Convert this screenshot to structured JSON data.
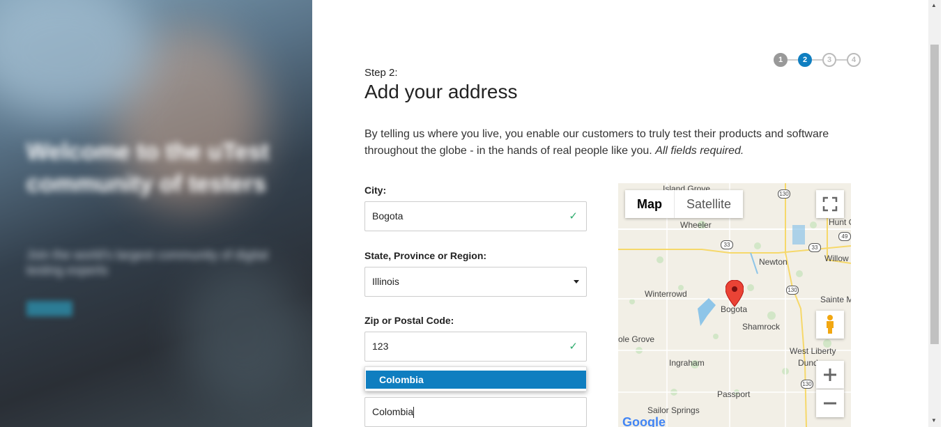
{
  "hero": {
    "title": "Welcome to the uTest community of testers",
    "subtitle": "Join the world's largest community of digital testing experts",
    "button": "Learn"
  },
  "stepper": {
    "steps": [
      "1",
      "2",
      "3",
      "4"
    ],
    "current": 2
  },
  "form": {
    "step_label": "Step 2:",
    "title": "Add your address",
    "intro": "By telling us where you live, you enable our customers to truly test their products and software throughout the globe - in the hands of real people like you.",
    "intro_required": "All fields required.",
    "city_label": "City:",
    "city_value": "Bogota",
    "state_label": "State, Province or Region:",
    "state_value": "Illinois",
    "zip_label": "Zip or Postal Code:",
    "zip_value": "123",
    "country_suggestion": "Colombia",
    "country_value": "Colombia"
  },
  "map": {
    "type_map": "Map",
    "type_satellite": "Satellite",
    "labels": {
      "island_grove": "Island Grove",
      "hunt_city": "Hunt C",
      "wheeler": "Wheeler",
      "willow_hill": "Willow",
      "newton": "Newton",
      "winterrowd": "Winterrowd",
      "sainte_marie": "Sainte M",
      "bogota": "Bogota",
      "shamrock": "Shamrock",
      "olive_grove": "ole Grove",
      "west_liberty": "West Liberty",
      "dundas": "Dund",
      "ingraham": "Ingraham",
      "passport": "Passport",
      "sailor_springs": "Sailor Springs",
      "google": "Google"
    },
    "shields": [
      "130",
      "33",
      "33",
      "49",
      "130",
      "130"
    ],
    "colors": {
      "road": "#f6d86a",
      "water": "#8ec5e8",
      "pin": "#ea4335"
    }
  }
}
